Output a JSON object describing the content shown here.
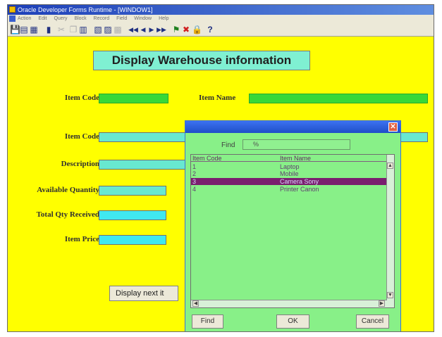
{
  "window": {
    "title": "Oracle Developer Forms Runtime - [WINDOW1]",
    "menu": [
      "Action",
      "Edit",
      "Query",
      "Block",
      "Record",
      "Field",
      "Window",
      "Help"
    ]
  },
  "toolbar": {
    "icons": [
      "save-icon",
      "print-icon",
      "close-form-icon",
      "cut-icon",
      "copy-icon",
      "paste-icon",
      "first-record-icon",
      "previous-record-icon",
      "next-record-icon",
      "last-record-icon",
      "insert-record-icon",
      "delete-record-icon",
      "lock-record-icon",
      "help-icon"
    ]
  },
  "form": {
    "heading": "Display Warehouse information",
    "item_code_label": "Item Code",
    "item_name_label": "Item Name",
    "item_code2_label": "Item Code",
    "description_label": "Description",
    "available_qty_label": "Available Quantity",
    "total_qty_label": "Total Qty Received",
    "price_label": "Item Price",
    "next_button": "Display next it"
  },
  "lov": {
    "find_label": "Find",
    "find_value": "%",
    "columns": [
      "Item Code",
      "Item Name"
    ],
    "rows": [
      {
        "code": "1",
        "name": "Laptop"
      },
      {
        "code": "2",
        "name": "Mobile"
      },
      {
        "code": "3",
        "name": "Camera Sony"
      },
      {
        "code": "4",
        "name": "Printer Canon"
      }
    ],
    "selected_index": 2,
    "buttons": {
      "find": "Find",
      "ok": "OK",
      "cancel": "Cancel"
    }
  },
  "colors": {
    "canvas": "#ffff00",
    "heading_bg": "#7ff0d2",
    "dialog_bg": "#88f088",
    "selection": "#7a1f6e",
    "titlebar": "#1d3fb8"
  }
}
